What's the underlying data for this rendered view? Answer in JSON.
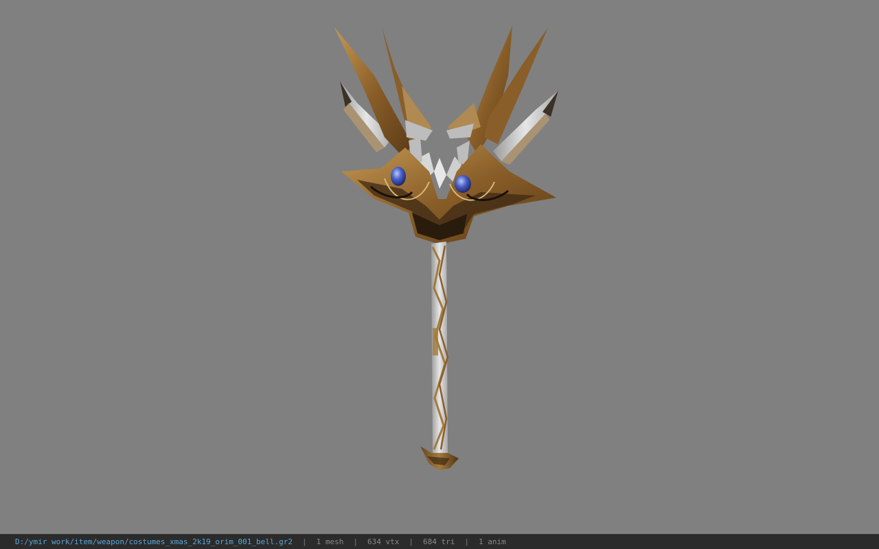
{
  "viewer": {
    "background_color": "#808080",
    "model_icon": "bell-mace-3d-model"
  },
  "status_bar": {
    "file_path": "D:/ymir work/item/weapon/costumes_xmas_2k19_orim_001_bell.gr2",
    "mesh_count": "1 mesh",
    "vertex_count": "634 vtx",
    "triangle_count": "684 tri",
    "anim_count": "1 anim",
    "separator": "|",
    "path_color": "#5aa8d8",
    "stat_color": "#8a8a8a"
  }
}
